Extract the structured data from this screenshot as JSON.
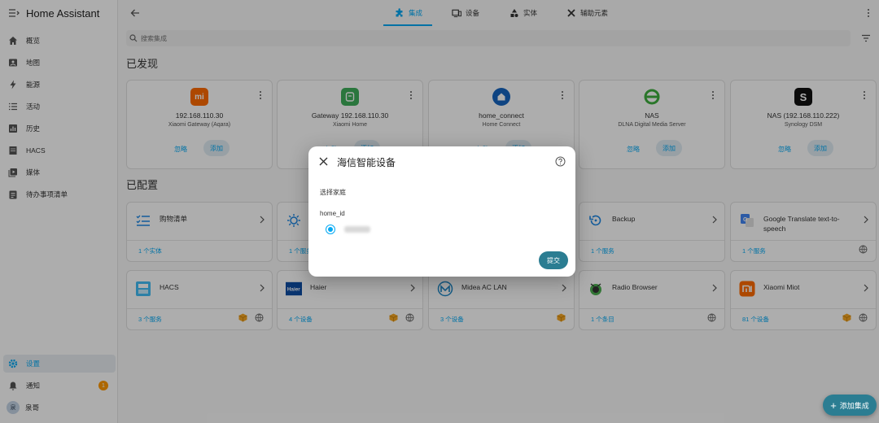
{
  "app": {
    "title": "Home Assistant"
  },
  "sidebar": {
    "items": [
      {
        "label": "概览",
        "icon": "home-icon"
      },
      {
        "label": "地图",
        "icon": "map-icon"
      },
      {
        "label": "能源",
        "icon": "lightning-icon"
      },
      {
        "label": "活动",
        "icon": "list-icon"
      },
      {
        "label": "历史",
        "icon": "chart-icon"
      },
      {
        "label": "HACS",
        "icon": "hacs-icon"
      },
      {
        "label": "媒体",
        "icon": "media-icon"
      },
      {
        "label": "待办事项清单",
        "icon": "clipboard-icon"
      }
    ],
    "settings": "设置",
    "notifications": "通知",
    "notification_count": "1",
    "user": "泉哥",
    "avatar_letter": "泉"
  },
  "tabs": [
    {
      "label": "集成",
      "icon": "puzzle-icon",
      "active": true
    },
    {
      "label": "设备",
      "icon": "devices-icon"
    },
    {
      "label": "实体",
      "icon": "shapes-icon"
    },
    {
      "label": "辅助元素",
      "icon": "tools-icon"
    }
  ],
  "search": {
    "placeholder": "搜索集成"
  },
  "discovered": {
    "title": "已发现",
    "ignore_label": "忽略",
    "add_label": "添加",
    "cards": [
      {
        "name": "192.168.110.30",
        "sub": "Xiaomi Gateway (Aqara)",
        "icon": "mi-logo-icon",
        "logo_text": "mi"
      },
      {
        "name": "Gateway 192.168.110.30",
        "sub": "Xiaomi Home",
        "icon": "mijia-logo-icon",
        "logo_text": ""
      },
      {
        "name": "home_connect",
        "sub": "Home Connect",
        "icon": "home-connect-logo-icon",
        "logo_text": ""
      },
      {
        "name": "NAS",
        "sub": "DLNA Digital Media Server",
        "icon": "dlna-logo-icon",
        "logo_text": ""
      },
      {
        "name": "NAS (192.168.110.222)",
        "sub": "Synology DSM",
        "icon": "synology-logo-icon",
        "logo_text": "S"
      }
    ]
  },
  "configured": {
    "title": "已配置",
    "cards": [
      {
        "name": "购物清单",
        "foot": "1 个实体"
      },
      {
        "name": "",
        "foot": "1 个服务"
      },
      {
        "name": "",
        "foot": ""
      },
      {
        "name": "Backup",
        "foot": "1 个服务"
      },
      {
        "name": "Google Translate text-to-speech",
        "foot": "1 个服务"
      },
      {
        "name": "HACS",
        "foot": "3 个服务"
      },
      {
        "name": "Haier",
        "foot": "4 个设备"
      },
      {
        "name": "Midea AC LAN",
        "foot": "3 个设备"
      },
      {
        "name": "Radio Browser",
        "foot": "1 个条目"
      },
      {
        "name": "Xiaomi Miot",
        "foot": "81 个设备"
      }
    ]
  },
  "dialog": {
    "title": "海信智能设备",
    "hint": "选择家庭",
    "field_label": "home_id",
    "submit": "提交"
  },
  "fab": {
    "label": "添加集成"
  },
  "colors": {
    "accent": "#03a9f4",
    "primary_button": "#2b7d92"
  }
}
